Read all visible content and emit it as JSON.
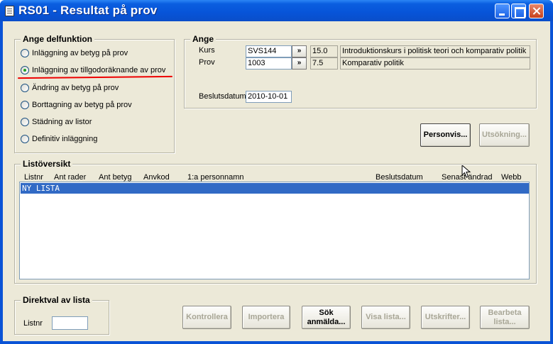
{
  "window": {
    "title": "RS01 - Resultat på prov"
  },
  "delfunktion": {
    "legend": "Ange delfunktion",
    "options": [
      {
        "label": "Inläggning av betyg på prov",
        "selected": false
      },
      {
        "label": "Inläggning av tillgodoräknande av prov",
        "selected": true
      },
      {
        "label": "Ändring av betyg på prov",
        "selected": false
      },
      {
        "label": "Borttagning av betyg på prov",
        "selected": false
      },
      {
        "label": "Städning av listor",
        "selected": false
      },
      {
        "label": "Definitiv inläggning",
        "selected": false
      }
    ]
  },
  "ange": {
    "legend": "Ange",
    "kurs_label": "Kurs",
    "kurs_value": "SVS144",
    "kurs_pick": "»",
    "kurs_points": "15.0",
    "kurs_name": "Introduktionskurs i politisk teori och komparativ politik",
    "prov_label": "Prov",
    "prov_value": "1003",
    "prov_pick": "»",
    "prov_points": "7.5",
    "prov_name": "Komparativ politik",
    "beslutsdatum_label": "Beslutsdatum",
    "beslutsdatum_value": "2010-10-01"
  },
  "actions": {
    "personvis": "Personvis...",
    "utsokning": "Utsökning..."
  },
  "listoversikt": {
    "legend": "Listöversikt",
    "columns": {
      "listnr": "Listnr",
      "ant_rader": "Ant rader",
      "ant_betyg": "Ant betyg",
      "anvkod": "Anvkod",
      "personnamn": "1:a personnamn",
      "beslutsdatum": "Beslutsdatum",
      "senast_andrad": "Senast ändrad",
      "webb": "Webb"
    },
    "rows": [
      "NY LISTA"
    ]
  },
  "direktval": {
    "legend": "Direktval av lista",
    "listnr_label": "Listnr",
    "listnr_value": ""
  },
  "bottom_buttons": {
    "kontrollera": "Kontrollera",
    "importera": "Importera",
    "sok_anmalda_1": "Sök",
    "sok_anmalda_2": "anmälda...",
    "visa_lista": "Visa lista...",
    "utskrifter": "Utskrifter...",
    "bearbeta_1": "Bearbeta",
    "bearbeta_2": "lista..."
  }
}
